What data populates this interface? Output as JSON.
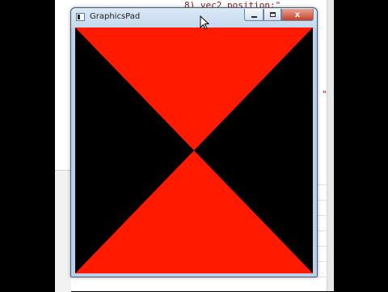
{
  "window": {
    "title": "GraphicsPad",
    "min_icon": "minimize-icon",
    "max_icon": "maximize-icon",
    "close_label": "x"
  },
  "canvas": {
    "background": "#000000",
    "triangle_color": "#ff1a00",
    "triangles": [
      {
        "name": "top-triangle",
        "vertices_ndc": [
          [
            -1,
            1
          ],
          [
            1,
            1
          ],
          [
            0,
            0
          ]
        ]
      },
      {
        "name": "bottom-triangle",
        "vertices_ndc": [
          [
            -1,
            -1
          ],
          [
            1,
            -1
          ],
          [
            0,
            0
          ]
        ]
      }
    ]
  },
  "editor": {
    "code_line_1": "8) vec2 position;\"",
    "code_line_2": "                  ",
    "code_fragment": "\""
  },
  "colors": {
    "titlebar": "#c4d9ee",
    "close_button": "#c7412a",
    "window_frame": "#b9d1ea"
  }
}
